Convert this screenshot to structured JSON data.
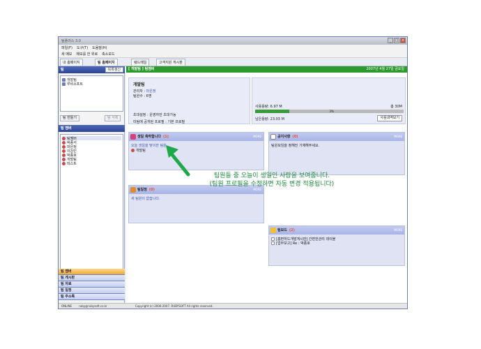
{
  "window": {
    "title": "팀플러스 3.0"
  },
  "menu": [
    "파일(F)",
    "도구(T)",
    "도움말(H)"
  ],
  "toolbar": [
    "새 메모",
    "메모를 한 위로",
    "축소모드"
  ],
  "tabs": [
    "내 홈페이지",
    "팀 홈페이지",
    "웨드메일",
    "고객지원 게시판"
  ],
  "sidebar": {
    "team_header": "팀",
    "refresh": "목록갱신",
    "teams": [
      "개발팀",
      "루비소프트"
    ],
    "btn_make": "팀 만들기",
    "btn_delete": "팀 삭제",
    "member_header": "팀 멤버",
    "members": [
      "팀멤버",
      "박종석",
      "마은정",
      "이강민",
      "박종호",
      "개발팀",
      "테스트"
    ],
    "nav": [
      "팀 멤버",
      "팀 게시판",
      "팀 자료",
      "팀 일정",
      "팀 주소록"
    ]
  },
  "main": {
    "header": "[ 개발팀 ] 팀멤버",
    "date": "2007년 4월 27일 금요일",
    "team_name": "개발팀",
    "owner_label": "관리자 :",
    "owner_value": "마은정",
    "count_label": "팀원수 :",
    "count_value": "6명",
    "invite_label": "초대설정 :",
    "invite_value": "운영자만 초대가능",
    "public_label": "미팀에 공개된 프로필 :",
    "public_value": "기본 프로필",
    "usage_label": "사용용량: 6.97 M",
    "usage_total": "총 30M",
    "usage_percent": "3%",
    "usage_fraction": 0.23,
    "remain_label": "남은용량: 23.03 M",
    "usage_btn": "사용내역보기"
  },
  "cards": {
    "birthday": {
      "title": "생일 축하합니다",
      "badge": "(1)",
      "more": "MORE",
      "line": "오늘 생일을 맞이한 팀원",
      "member": "개발팀"
    },
    "notice": {
      "title": "공지사항",
      "badge": "(0)",
      "more": "MORE",
      "line": "팀원모임을 정해진 기재해주세요."
    },
    "schedule": {
      "title": "팀일정",
      "badge": "(0)",
      "more": "MORE",
      "line": "새 팀원이 없습니다."
    },
    "board": {
      "title": "팀보드",
      "badge": "(2)",
      "more": "MORE",
      "items": [
        "[홈편하드개발게시판] 간편한관리 데이블",
        "[업무보고] Re : 박종호"
      ]
    }
  },
  "callout": {
    "line1": "팀원들 중 오늘이 생일인 사람을 보여줍니다.",
    "line2": "(팀원 프로필을 수정하면 자동 변경 적용됩니다)"
  },
  "status": {
    "online": "ONLINE",
    "user": "ruby@rubysoft.co.kr",
    "copyright": "Copyright (c) 2006-2007. RUBYSOFT All rights reserved."
  },
  "colors": {
    "header_green": "#2c9a2c",
    "nav_active": "#f0a832",
    "accent_blue": "#2d4596",
    "callout_green": "#1c8a3c"
  }
}
